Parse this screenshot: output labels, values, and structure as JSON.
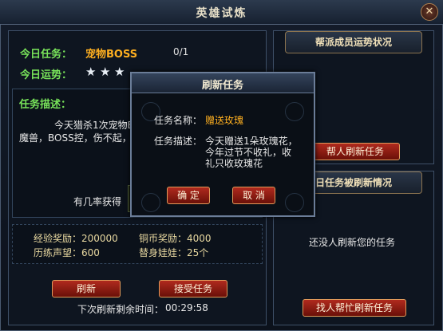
{
  "window": {
    "title": "英雄试炼",
    "close_glyph": "✕"
  },
  "task": {
    "today_task_label": "今日任务：",
    "today_task_value": "宠物BOSS",
    "progress": "0/1",
    "today_luck_label": "今日运势：",
    "luck_stars": 3,
    "desc_label": "任务描述：",
    "desc_line1": "今天猎杀1次宠物BOSS",
    "desc_line2": "魔兽，BOSS控，伤不起，",
    "chance_label": "有几率获得"
  },
  "rewards": {
    "exp": "经验奖励：200000",
    "coin": "铜币奖励：4000",
    "fame": "历练声望：600",
    "doll": "替身娃娃：25个"
  },
  "buttons": {
    "refresh": "刷新",
    "accept": "接受任务",
    "help_refresh": "帮人刷新任务",
    "find_help": "找人帮忙刷新任务"
  },
  "timer": {
    "label": "下次刷新剩余时间：",
    "value": "00:29:58"
  },
  "side": {
    "guild_title": "帮派成员运势状况",
    "refresh_status_title": "日任务被刷新情况",
    "no_refresh_text": "还没人刷新您的任务"
  },
  "dialog": {
    "title": "刷新任务",
    "name_label": "任务名称：",
    "name_value": "赠送玫瑰",
    "desc_label": "任务描述：",
    "desc_line1": "今天赠送1朵玫瑰花，",
    "desc_line2": "今年过节不收礼，收",
    "desc_line3": "礼只收玫瑰花",
    "ok": "确 定",
    "cancel": "取 消"
  },
  "colors": {
    "green": "#78e35a",
    "orange": "#ffb020",
    "button_red": "#b02a1e"
  }
}
